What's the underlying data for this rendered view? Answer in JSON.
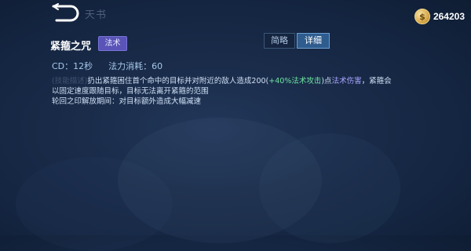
{
  "header": {
    "title": "天书",
    "currency": {
      "icon": "gold-coin-icon",
      "value": "264203"
    }
  },
  "skill": {
    "name": "紧箍之咒",
    "tag": "法术",
    "cd": "CD：12秒",
    "cost": "法力消耗：60"
  },
  "tabs": [
    {
      "label": "简略",
      "selected": false
    },
    {
      "label": "详细",
      "selected": true
    }
  ],
  "description": {
    "line1": {
      "faded_prefix": "(技能描述)",
      "text1": "扔出紧箍困住首个命中的目标并对附近的敌人造成200(",
      "bonus": "+40%法术攻击",
      "text2": ")点",
      "damage_type": "法术伤害",
      "text3": "，紧箍会"
    },
    "line2": "以固定速度跟随目标，目标无法离开紧箍的范围",
    "line3": "轮回之印解放期间：对目标额外造成大幅减速"
  },
  "colors": {
    "accent_green": "#6ee2a2",
    "accent_purple": "#a9a4ff",
    "tag_bg": "#5a54b8",
    "selected_tab": "#2f5c8e"
  }
}
